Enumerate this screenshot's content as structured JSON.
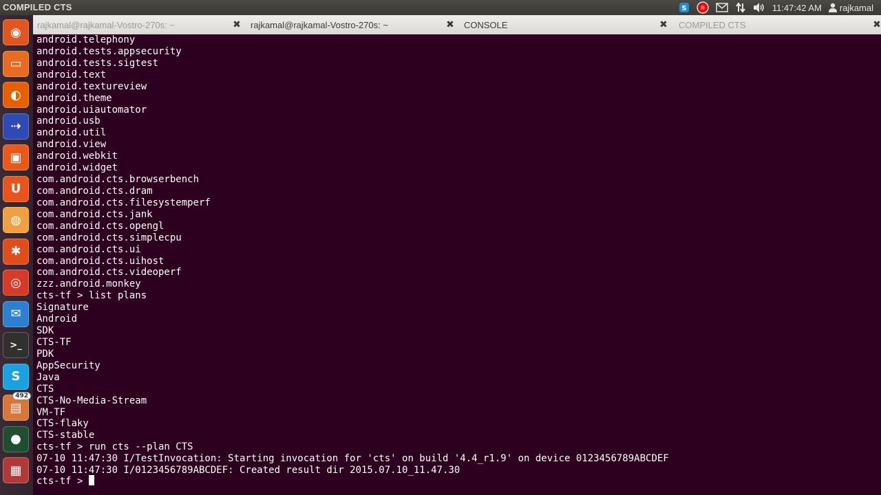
{
  "topbar": {
    "window_title": "COMPILED CTS",
    "clock": "11:47:42 AM",
    "user": "rajkamal",
    "icons": [
      "skype-tray-icon",
      "record-icon",
      "mail-icon",
      "network-icon",
      "volume-icon",
      "user-icon"
    ],
    "colors": {
      "record": "#e01010",
      "skype": "#1a8fd8"
    }
  },
  "launcher": {
    "items": [
      {
        "name": "dash-home-icon",
        "color": "#e0561f"
      },
      {
        "name": "files-icon",
        "color": "#e96b1f"
      },
      {
        "name": "firefox-icon",
        "color": "#e66000"
      },
      {
        "name": "remote-desktop-icon",
        "color": "#2f49b5"
      },
      {
        "name": "ubuntu-software-icon",
        "color": "#e9591c"
      },
      {
        "name": "ubuntu-one-icon",
        "color": "#e9541a"
      },
      {
        "name": "blender-icon",
        "color": "#f0a040"
      },
      {
        "name": "system-settings-icon",
        "color": "#e14c1d"
      },
      {
        "name": "disk-icon",
        "color": "#d83a2a"
      },
      {
        "name": "thunderbird-icon",
        "color": "#2f7fd0"
      },
      {
        "name": "terminal-icon",
        "color": "#303030"
      },
      {
        "name": "skype-icon",
        "color": "#1aa1e1"
      },
      {
        "name": "update-manager-icon",
        "color": "#d9773a",
        "badge": "492"
      },
      {
        "name": "camera-icon",
        "color": "#1f4f2f"
      },
      {
        "name": "workspace-switcher-icon",
        "color": "#b03a3a"
      }
    ]
  },
  "tabs": [
    {
      "label": "rajkamal@rajkamal-Vostro-270s: ~",
      "active": true
    },
    {
      "label": "rajkamal@rajkamal-Vostro-270s: ~",
      "active": false
    },
    {
      "label": "CONSOLE",
      "active": false
    },
    {
      "label": "COMPILED CTS",
      "active": true
    }
  ],
  "terminal": {
    "lines": [
      "android.telephony",
      "android.tests.appsecurity",
      "android.tests.sigtest",
      "android.text",
      "android.textureview",
      "android.theme",
      "android.uiautomator",
      "android.usb",
      "android.util",
      "android.view",
      "android.webkit",
      "android.widget",
      "com.android.cts.browserbench",
      "com.android.cts.dram",
      "com.android.cts.filesystemperf",
      "com.android.cts.jank",
      "com.android.cts.opengl",
      "com.android.cts.simplecpu",
      "com.android.cts.ui",
      "com.android.cts.uihost",
      "com.android.cts.videoperf",
      "zzz.android.monkey",
      "cts-tf > list plans",
      "Signature",
      "Android",
      "SDK",
      "CTS-TF",
      "PDK",
      "AppSecurity",
      "Java",
      "CTS",
      "CTS-No-Media-Stream",
      "VM-TF",
      "CTS-flaky",
      "CTS-stable",
      "cts-tf > run cts --plan CTS",
      "07-10 11:47:30 I/TestInvocation: Starting invocation for 'cts' on build '4.4_r1.9' on device 0123456789ABCDEF",
      "07-10 11:47:30 I/0123456789ABCDEF: Created result dir 2015.07.10_11.47.30"
    ],
    "prompt": "cts-tf > "
  }
}
